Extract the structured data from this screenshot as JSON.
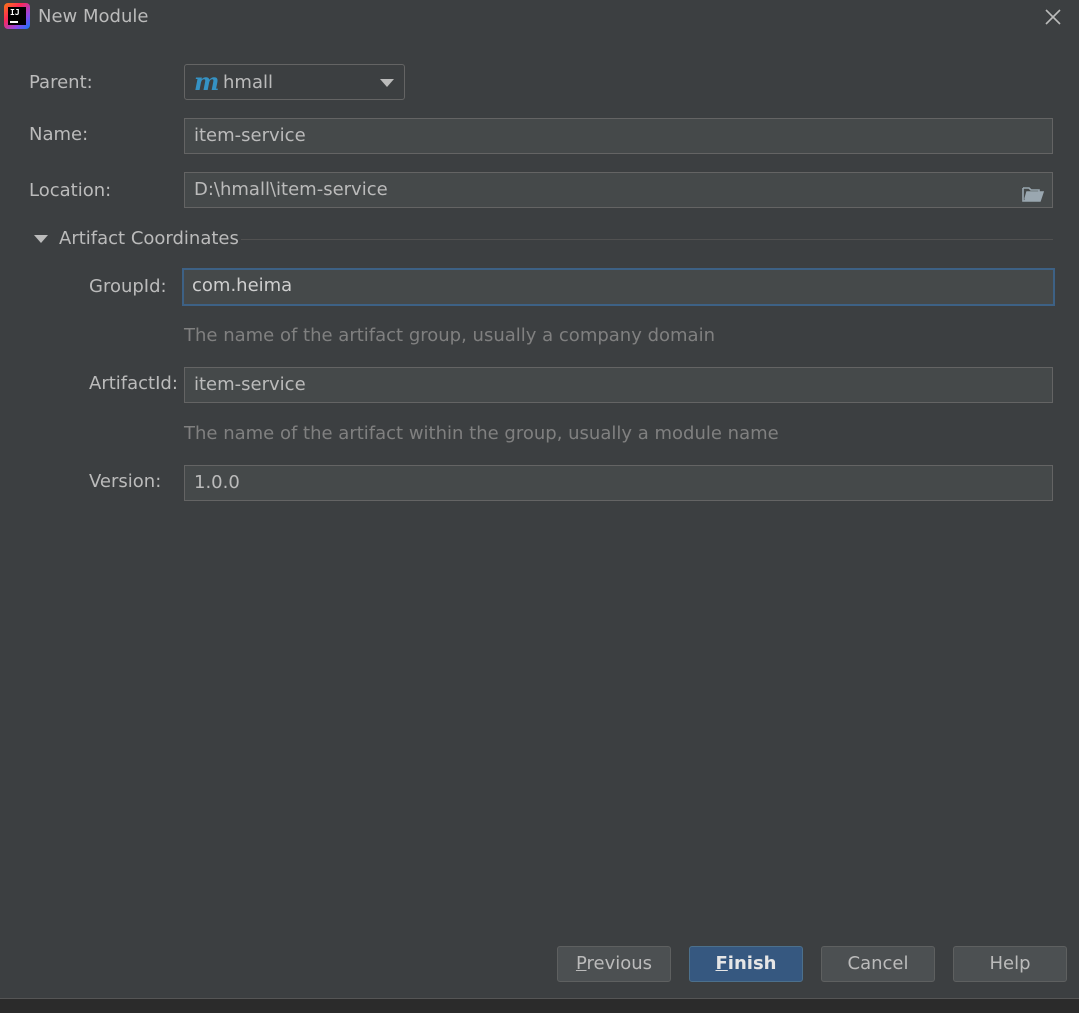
{
  "window": {
    "title": "New Module",
    "app_icon": "intellij-idea-icon"
  },
  "form": {
    "parent": {
      "label": "Parent:",
      "value": "hmall",
      "icon": "maven-icon"
    },
    "name": {
      "label": "Name:",
      "value": "item-service"
    },
    "location": {
      "label": "Location:",
      "value": "D:\\hmall\\item-service",
      "browse_icon": "folder-icon"
    },
    "artifact_section": {
      "label": "Artifact Coordinates",
      "group_id": {
        "label": "GroupId:",
        "value": "com.heima",
        "hint": "The name of the artifact group, usually a company domain"
      },
      "artifact_id": {
        "label": "ArtifactId:",
        "value": "item-service",
        "hint": "The name of the artifact within the group, usually a module name"
      },
      "version": {
        "label": "Version:",
        "value": "1.0.0"
      }
    }
  },
  "buttons": {
    "previous": {
      "mnemonic": "P",
      "rest": "revious"
    },
    "finish": {
      "mnemonic": "F",
      "rest": "inish"
    },
    "cancel": "Cancel",
    "help": "Help"
  },
  "colors": {
    "background": "#3c3f41",
    "field_background": "#45494a",
    "focus_border": "#3d6185",
    "primary_button": "#365880",
    "maven_icon": "#3592c4"
  }
}
